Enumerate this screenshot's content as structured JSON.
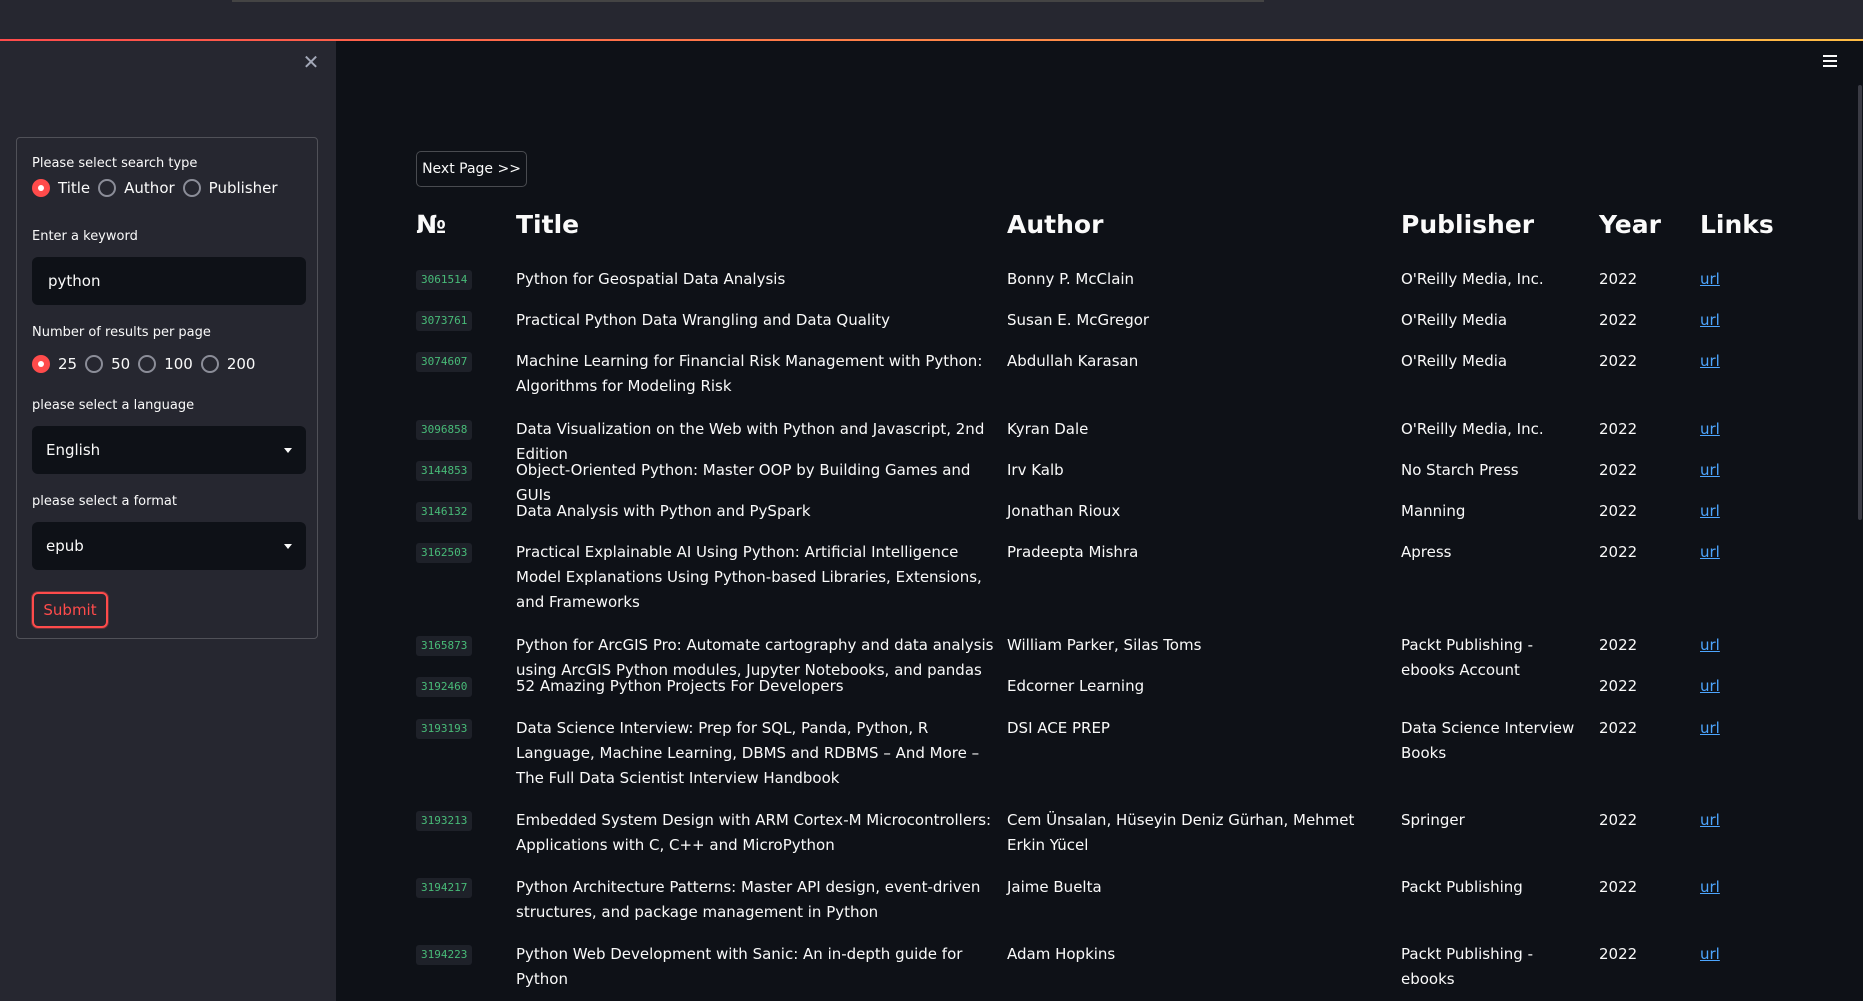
{
  "sidebar": {
    "search_type_label": "Please select search type",
    "search_types": [
      "Title",
      "Author",
      "Publisher"
    ],
    "search_type_selected": "Title",
    "keyword_label": "Enter a keyword",
    "keyword_value": "python",
    "results_label": "Number of results per page",
    "results_options": [
      "25",
      "50",
      "100",
      "200"
    ],
    "results_selected": "25",
    "language_label": "please select a language",
    "language_value": "English",
    "format_label": "please select a format",
    "format_value": "epub",
    "submit_label": "Submit"
  },
  "main": {
    "next_page_label": "Next Page >>",
    "headers": {
      "no": "№",
      "title": "Title",
      "author": "Author",
      "publisher": "Publisher",
      "year": "Year",
      "links": "Links"
    },
    "rows": [
      {
        "id": "3061514",
        "title": "Python for Geospatial Data Analysis",
        "author": "Bonny P. McClain",
        "publisher": "O'Reilly Media, Inc.",
        "year": "2022",
        "link": "url"
      },
      {
        "id": "3073761",
        "title": "Practical Python Data Wrangling and Data Quality",
        "author": "Susan E. McGregor",
        "publisher": "O'Reilly Media",
        "year": "2022",
        "link": "url"
      },
      {
        "id": "3074607",
        "title": "Machine Learning for Financial Risk Management with Python: Algorithms for Modeling Risk",
        "author": "Abdullah Karasan",
        "publisher": "O'Reilly Media",
        "year": "2022",
        "link": "url"
      },
      {
        "id": "3096858",
        "title": "Data Visualization on the Web with Python and Javascript, 2nd Edition",
        "author": "Kyran Dale",
        "publisher": "O'Reilly Media, Inc.",
        "year": "2022",
        "link": "url"
      },
      {
        "id": "3144853",
        "title": "Object-Oriented Python: Master OOP by Building Games and GUIs",
        "author": "Irv Kalb",
        "publisher": "No Starch Press",
        "year": "2022",
        "link": "url"
      },
      {
        "id": "3146132",
        "title": "Data Analysis with Python and PySpark",
        "author": "Jonathan Rioux",
        "publisher": "Manning",
        "year": "2022",
        "link": "url"
      },
      {
        "id": "3162503",
        "title": "Practical Explainable AI Using Python: Artificial Intelligence Model Explanations Using Python-based Libraries, Extensions, and Frameworks",
        "author": "Pradeepta Mishra",
        "publisher": "Apress",
        "year": "2022",
        "link": "url"
      },
      {
        "id": "3165873",
        "title": "Python for ArcGIS Pro: Automate cartography and data analysis using ArcGIS Python modules, Jupyter Notebooks, and pandas",
        "author": "William Parker, Silas Toms",
        "publisher": "Packt Publishing - ebooks Account",
        "year": "2022",
        "link": "url"
      },
      {
        "id": "3192460",
        "title": "52 Amazing Python Projects For Developers",
        "author": "Edcorner Learning",
        "publisher": "",
        "year": "2022",
        "link": "url"
      },
      {
        "id": "3193193",
        "title": "Data Science Interview: Prep for SQL, Panda, Python, R Language, Machine Learning, DBMS and RDBMS – And More – The Full Data Scientist Interview Handbook",
        "author": "DSI ACE PREP",
        "publisher": "Data Science Interview Books",
        "year": "2022",
        "link": "url"
      },
      {
        "id": "3193213",
        "title": "Embedded System Design with ARM Cortex-M Microcontrollers: Applications with C, C++ and MicroPython",
        "author": "Cem Ünsalan, Hüseyin Deniz Gürhan, Mehmet Erkin Yücel",
        "publisher": "Springer",
        "year": "2022",
        "link": "url"
      },
      {
        "id": "3194217",
        "title": "Python Architecture Patterns: Master API design, event-driven structures, and package management in Python",
        "author": "Jaime Buelta",
        "publisher": "Packt Publishing",
        "year": "2022",
        "link": "url"
      },
      {
        "id": "3194223",
        "title": "Python Web Development with Sanic: An in-depth guide for Python",
        "author": "Adam Hopkins",
        "publisher": "Packt Publishing - ebooks",
        "year": "2022",
        "link": "url"
      }
    ]
  }
}
